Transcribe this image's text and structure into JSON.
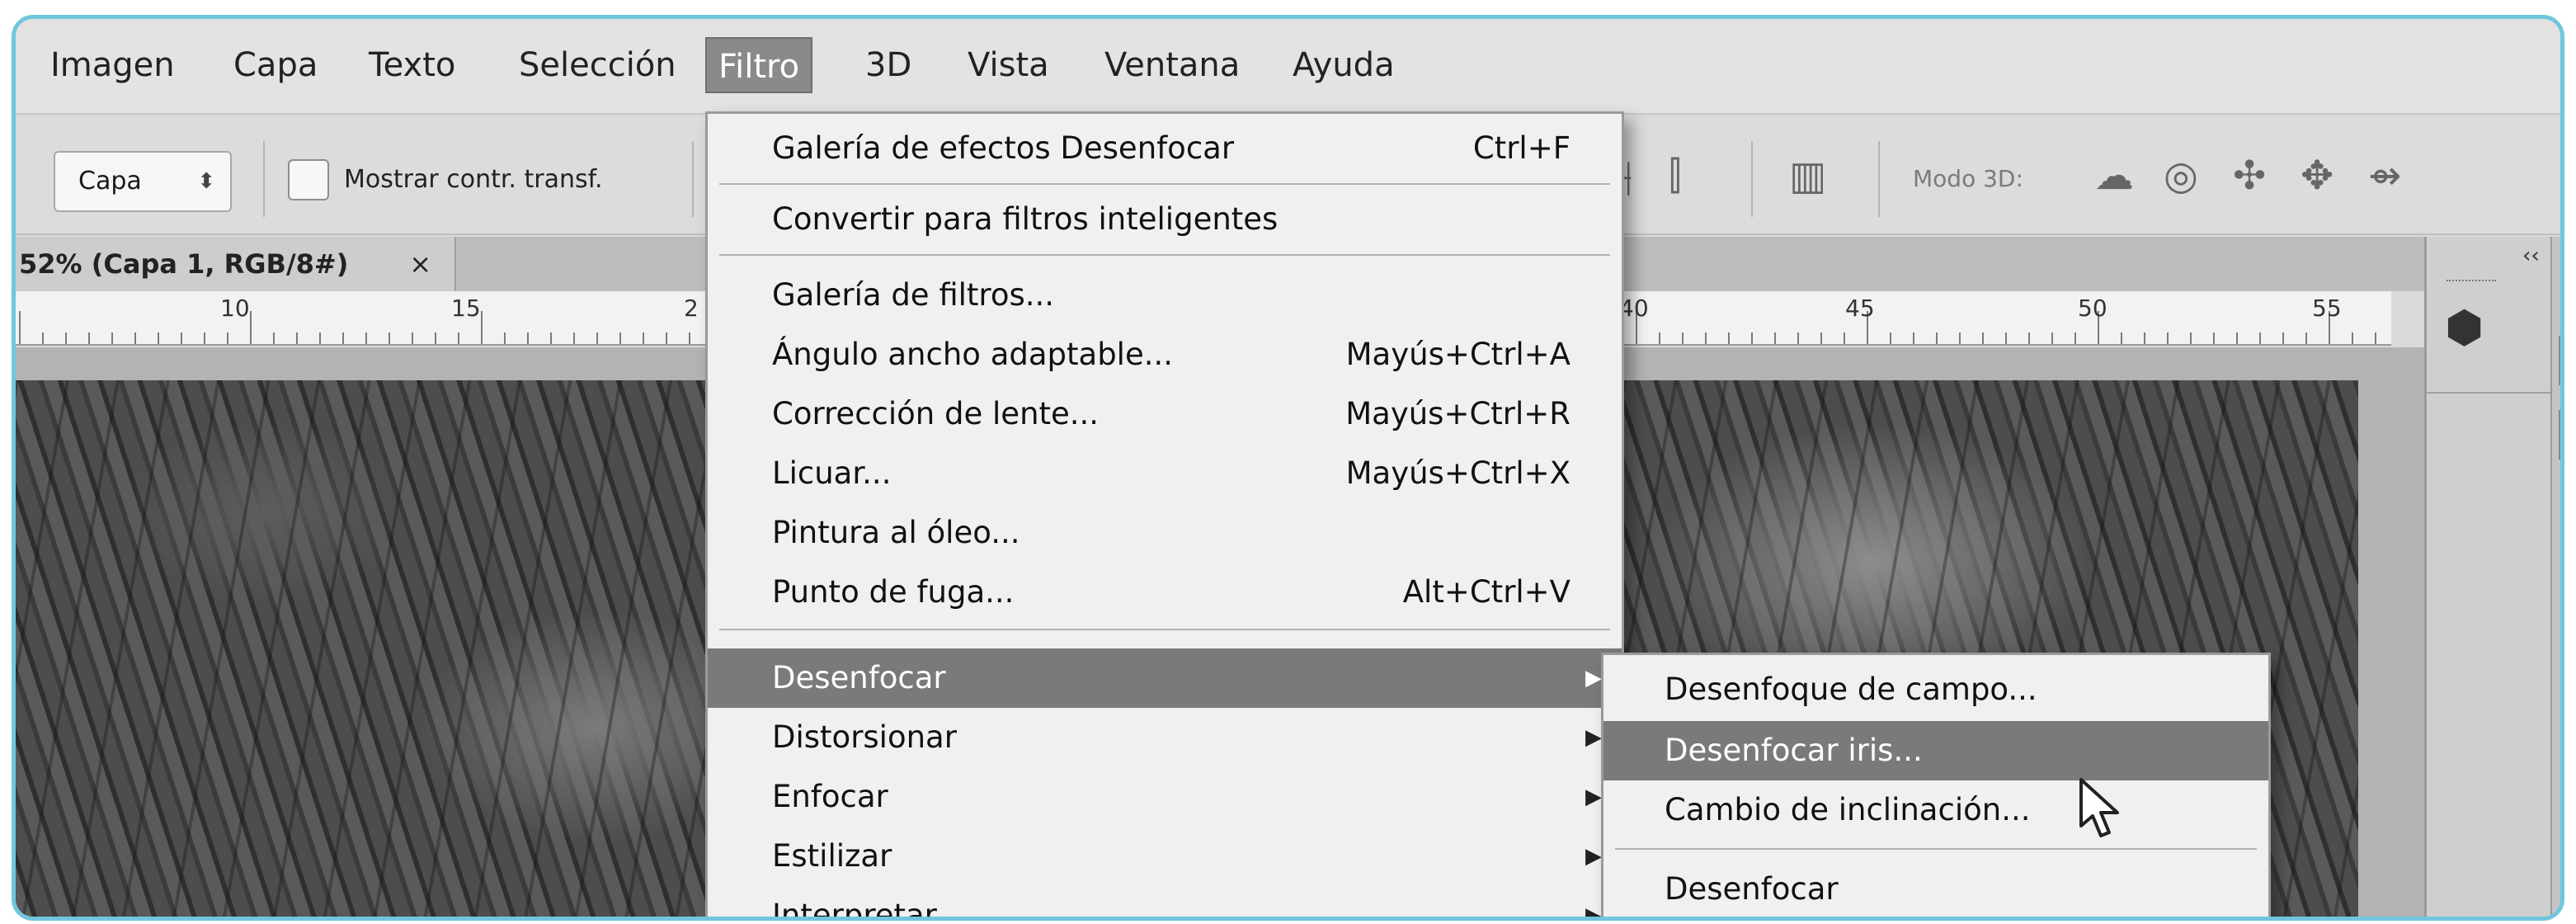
{
  "menubar": {
    "items": [
      {
        "label": "Imagen"
      },
      {
        "label": "Capa"
      },
      {
        "label": "Texto"
      },
      {
        "label": "Selección"
      },
      {
        "label": "Filtro",
        "active": true
      },
      {
        "label": "3D"
      },
      {
        "label": "Vista"
      },
      {
        "label": "Ventana"
      },
      {
        "label": "Ayuda"
      }
    ]
  },
  "options_bar": {
    "layer_select": "Capa",
    "show_transform_label": "Mostrar contr. transf.",
    "show_transform_checked": false,
    "mode3d_label": "Modo 3D:",
    "icons": [
      "align-center-icon",
      "distribute-icon",
      "auto-align-icon",
      "rotate-3d-icon",
      "roll-3d-icon",
      "drag-3d-icon",
      "slide-3d-icon",
      "scale-3d-icon"
    ]
  },
  "document": {
    "tab_title": "52% (Capa 1, RGB/8#)",
    "close_symbol": "×"
  },
  "ruler": {
    "labels": [
      "10",
      "15",
      "2",
      "40",
      "45",
      "50",
      "55"
    ]
  },
  "filter_menu": {
    "items": [
      {
        "label": "Galería de efectos Desenfocar",
        "shortcut": "Ctrl+F"
      },
      {
        "label": "Convertir para filtros inteligentes",
        "shortcut": ""
      },
      {
        "label": "Galería de filtros...",
        "shortcut": ""
      },
      {
        "label": "Ángulo ancho adaptable...",
        "shortcut": "Mayús+Ctrl+A"
      },
      {
        "label": "Corrección de lente...",
        "shortcut": "Mayús+Ctrl+R"
      },
      {
        "label": "Licuar...",
        "shortcut": "Mayús+Ctrl+X"
      },
      {
        "label": "Pintura al óleo...",
        "shortcut": ""
      },
      {
        "label": "Punto de fuga...",
        "shortcut": "Alt+Ctrl+V"
      },
      {
        "label": "Desenfocar",
        "submenu": true,
        "highlighted": true
      },
      {
        "label": "Distorsionar",
        "submenu": true
      },
      {
        "label": "Enfocar",
        "submenu": true
      },
      {
        "label": "Estilizar",
        "submenu": true
      },
      {
        "label": "Interpretar",
        "submenu": true
      }
    ]
  },
  "blur_submenu": {
    "items": [
      {
        "label": "Desenfoque de campo..."
      },
      {
        "label": "Desenfocar iris...",
        "highlighted": true
      },
      {
        "label": "Cambio de inclinación..."
      },
      {
        "label": "Desenfocar"
      }
    ]
  },
  "right_panel": {
    "collapse_symbol": "‹‹",
    "icon": "3d-cube-icon"
  },
  "colors": {
    "frame_border": "#6fc7de",
    "menu_highlight": "#7a7a7a",
    "menu_bg": "#f0f0f0"
  }
}
